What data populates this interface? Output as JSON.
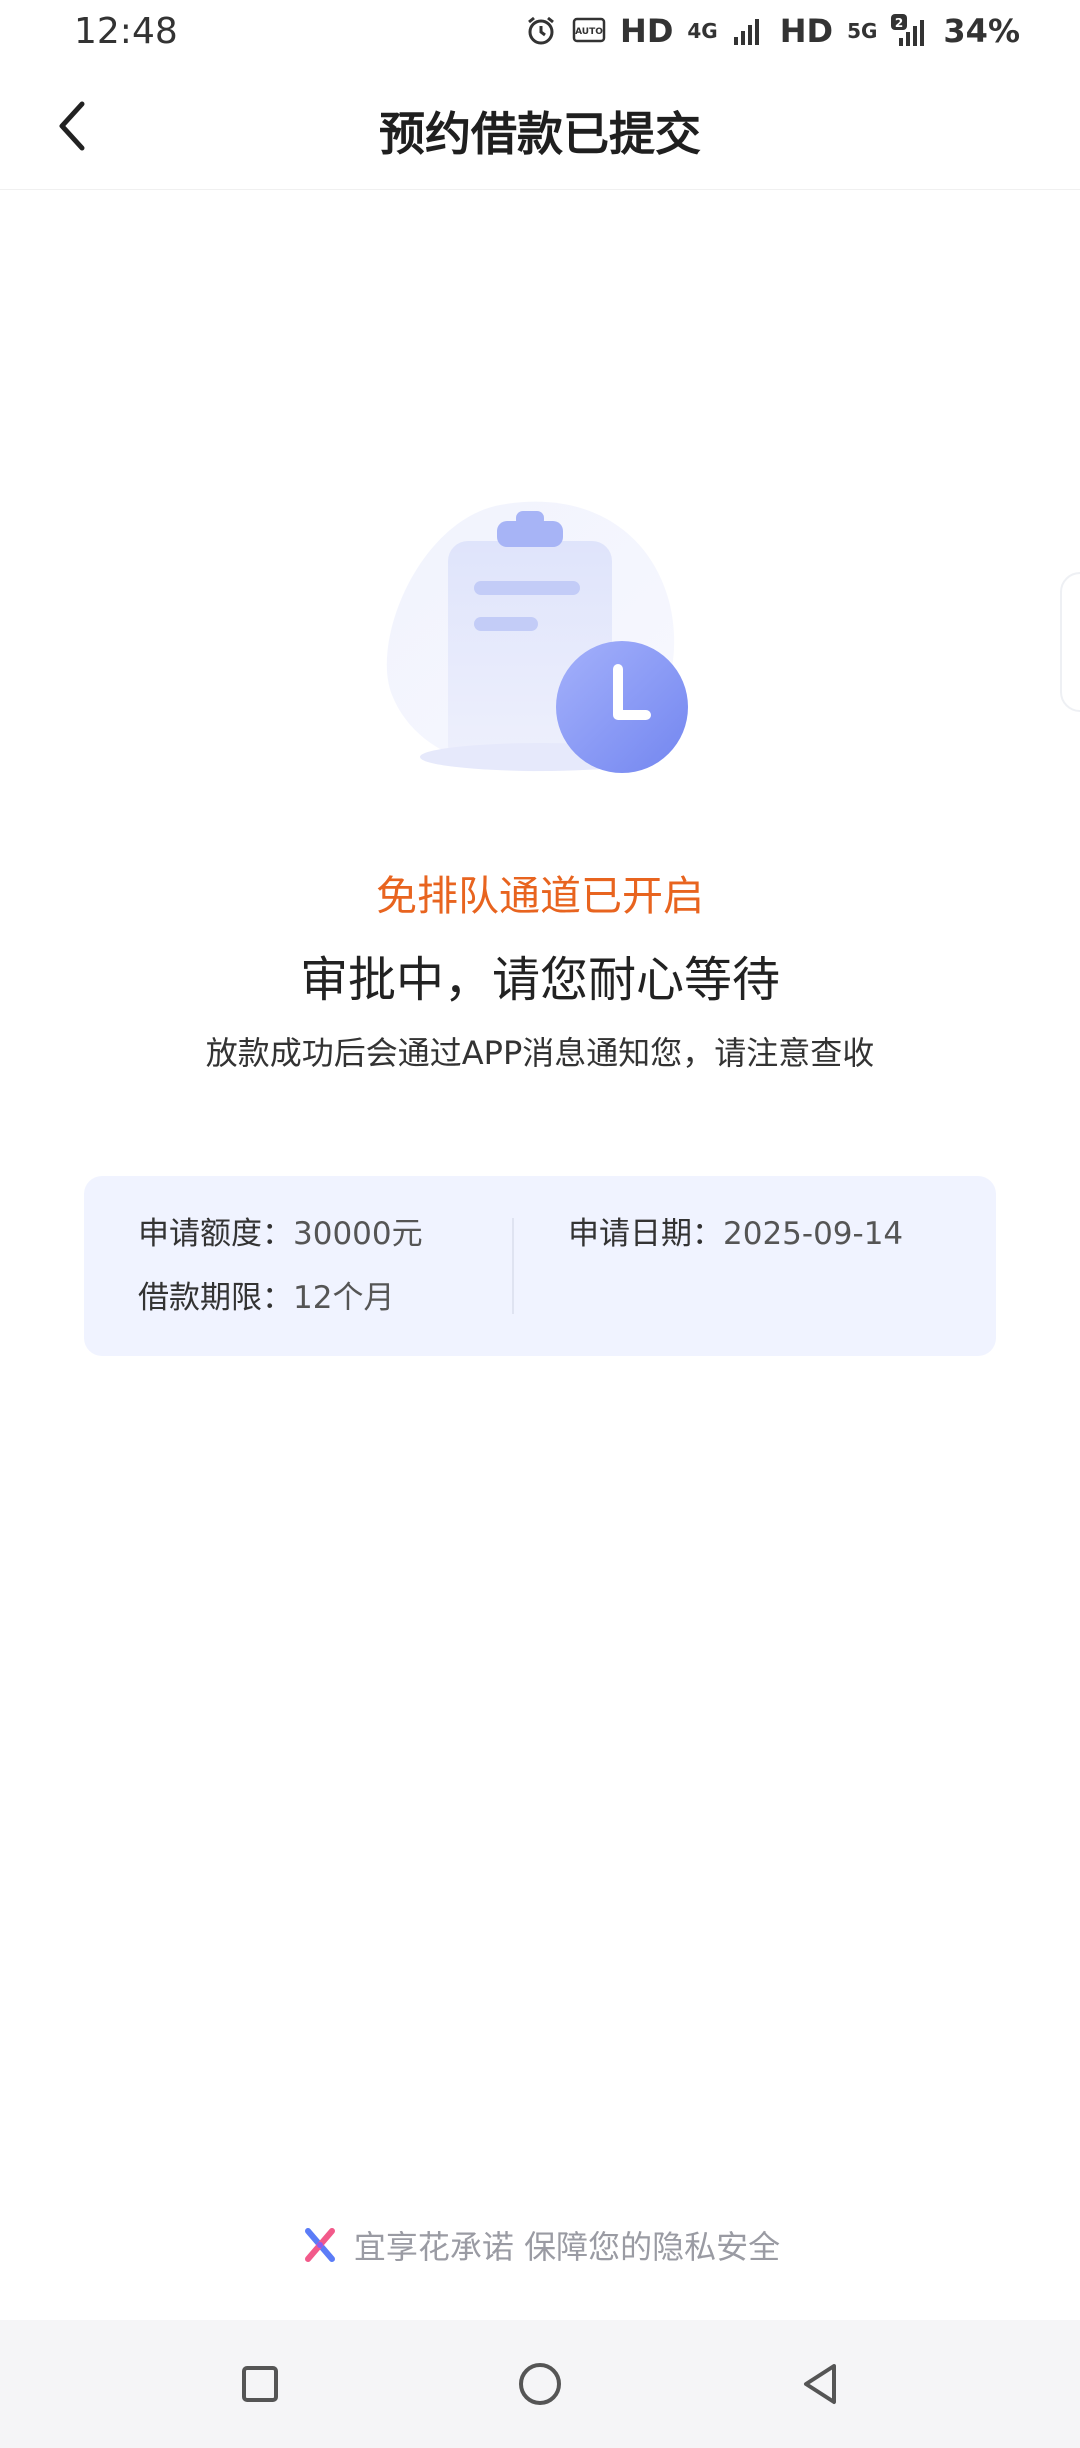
{
  "status_bar": {
    "time": "12:48",
    "hd1": "HD",
    "net1": "4G",
    "sim1": "1",
    "hd2": "HD",
    "net2": "5G",
    "sim2": "2",
    "battery": "34%"
  },
  "nav": {
    "title": "预约借款已提交",
    "back_icon": "chevron-left-icon"
  },
  "illustration": {
    "icon": "clipboard-clock-icon",
    "accent_color": "#7f93f5"
  },
  "status": {
    "channel": "免排队通道已开启",
    "main": "审批中，请您耐心等待",
    "notice": "放款成功后会通过APP消息通知您，请注意查收"
  },
  "info": {
    "amount_label": "申请额度：",
    "amount_value": "30000元",
    "term_label": "借款期限：",
    "term_value": "12个月",
    "date_label": "申请日期：",
    "date_value": "2025-09-14"
  },
  "footer": {
    "text": "宜享花承诺 保障您的隐私安全"
  },
  "colors": {
    "accent_orange": "#e8641f",
    "card_bg": "#f0f3ff"
  }
}
